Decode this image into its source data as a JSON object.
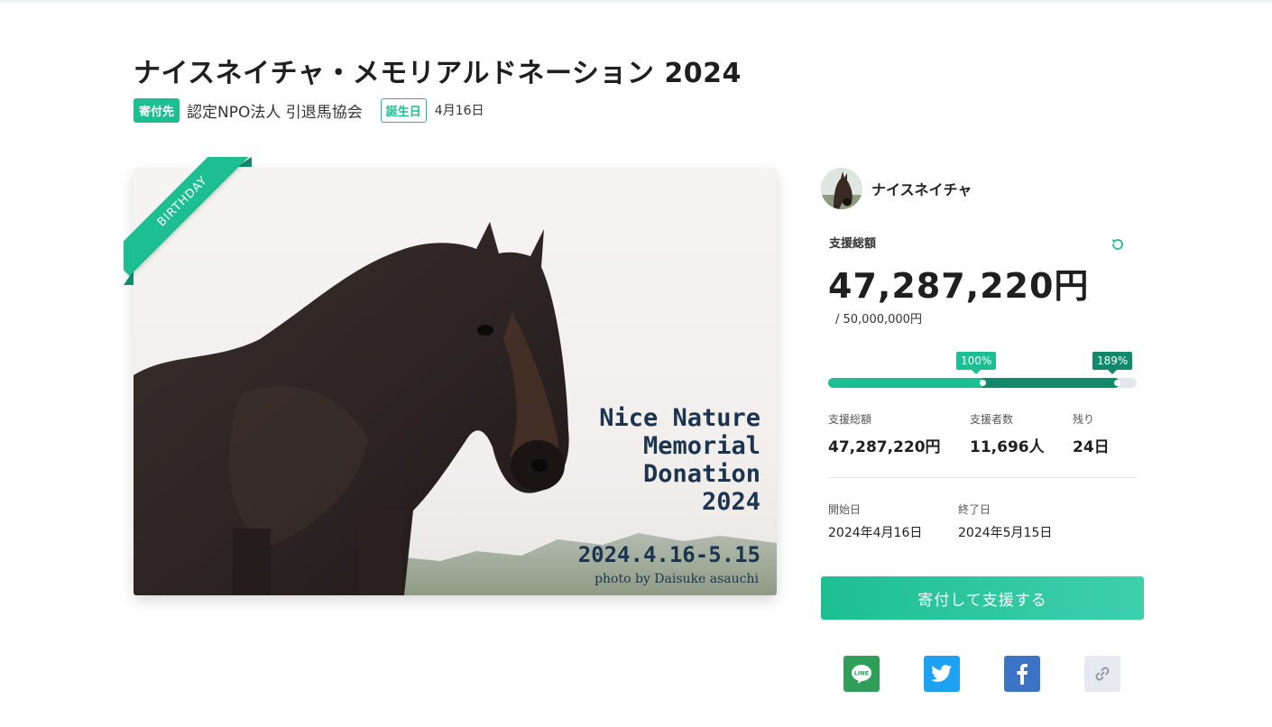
{
  "campaign": {
    "title": "ナイスネイチャ・メモリアルドネーション 2024",
    "recipient_tag": "寄付先",
    "recipient": "認定NPO法人 引退馬協会",
    "birthday_tag": "誕生日",
    "birthday": "4月16日"
  },
  "hero": {
    "ribbon": "BIRTHDAY",
    "text_lines": [
      "Nice Nature",
      "Memorial",
      "Donation",
      "2024"
    ],
    "dates": "2024.4.16-5.15",
    "credit": "photo by Daisuke asauchi"
  },
  "horse": {
    "name": "ナイスネイチャ"
  },
  "funding": {
    "total_label": "支援総額",
    "total_amount": "47,287,220円",
    "goal": "/ 50,000,000円",
    "progress_percent": 189,
    "milestone_percent": 100,
    "milestone_label": "100%",
    "progress_label": "189%"
  },
  "stats": [
    {
      "label": "支援総額",
      "value": "47,287,220円"
    },
    {
      "label": "支援者数",
      "value": "11,696人"
    },
    {
      "label": "残り",
      "value": "24日"
    }
  ],
  "dates": [
    {
      "label": "開始日",
      "value": "2024年4月16日"
    },
    {
      "label": "終了日",
      "value": "2024年5月15日"
    }
  ],
  "cta": {
    "donate_label": "寄付して支援する"
  },
  "share": {
    "line_label": "LINE",
    "icons": [
      "line-icon",
      "twitter-icon",
      "facebook-icon",
      "link-icon"
    ]
  },
  "colors": {
    "accent": "#1dbf92",
    "accent_dark": "#108a6b",
    "navy_text": "#1b3550"
  }
}
